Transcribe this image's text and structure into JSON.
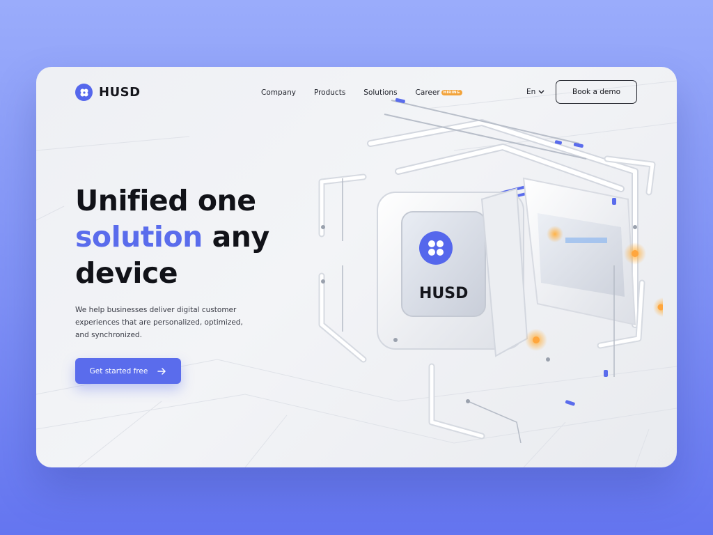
{
  "brand": {
    "name": "HUSD"
  },
  "nav": {
    "items": [
      "Company",
      "Products",
      "Solutions",
      "Career"
    ],
    "career_badge": "HIRING"
  },
  "header": {
    "language": "En",
    "cta_label": "Book a demo"
  },
  "hero": {
    "title_line1": "Unified one",
    "title_accent": "solution",
    "title_line2_rest": " any",
    "title_line3": "device",
    "subtitle": "We help businesses deliver digital customer experiences that are personalized, optimized, and synchronized.",
    "cta_label": "Get started free"
  },
  "device": {
    "label": "HUSD"
  },
  "icons": [
    "logo-mark-icon",
    "chevron-down-icon",
    "arrow-right-icon"
  ],
  "colors": {
    "accent": "#5a6cec",
    "badge": "#f2a33b",
    "background": "#8b9cf8",
    "card": "#eef0f4",
    "text": "#111218"
  }
}
